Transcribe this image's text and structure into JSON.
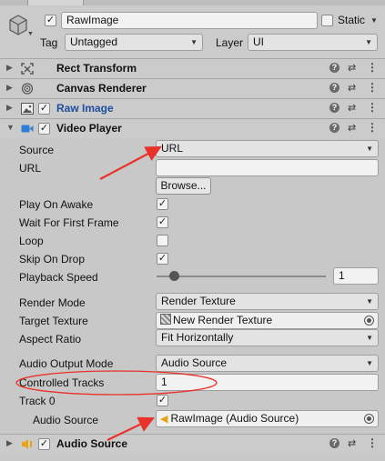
{
  "header": {
    "object_name": "RawImage",
    "static_label": "Static",
    "tag_label": "Tag",
    "tag_value": "Untagged",
    "layer_label": "Layer",
    "layer_value": "UI"
  },
  "components": {
    "rect_transform": "Rect Transform",
    "canvas_renderer": "Canvas Renderer",
    "raw_image": "Raw Image",
    "video_player": "Video Player",
    "audio_source": "Audio Source"
  },
  "video_player": {
    "source_label": "Source",
    "source_value": "URL",
    "url_label": "URL",
    "url_value": "",
    "browse_button": "Browse...",
    "play_on_awake_label": "Play On Awake",
    "play_on_awake": true,
    "wait_first_frame_label": "Wait For First Frame",
    "wait_first_frame": true,
    "loop_label": "Loop",
    "loop": false,
    "skip_on_drop_label": "Skip On Drop",
    "skip_on_drop": true,
    "playback_speed_label": "Playback Speed",
    "playback_speed_value": "1",
    "render_mode_label": "Render Mode",
    "render_mode_value": "Render Texture",
    "target_texture_label": "Target Texture",
    "target_texture_value": "New Render Texture",
    "aspect_ratio_label": "Aspect Ratio",
    "aspect_ratio_value": "Fit Horizontally",
    "audio_output_mode_label": "Audio Output Mode",
    "audio_output_mode_value": "Audio Source",
    "controlled_tracks_label": "Controlled Tracks",
    "controlled_tracks_value": "1",
    "track0_label": "Track 0",
    "track0": true,
    "track_audio_source_label": "Audio Source",
    "track_audio_source_value": "RawImage (Audio Source)"
  },
  "glyphs": {
    "check": "✓",
    "dropdown_arrow": "▼",
    "fold_closed": "▶",
    "fold_open": "▼",
    "help": "?",
    "preset": "⇄",
    "menu": "⋮"
  },
  "colors": {
    "annotation_red": "#e8322a",
    "video_icon_blue": "#2f7fd6",
    "raw_image_title_blue": "#1f4e9c",
    "audio_icon_orange": "#e8a317"
  }
}
